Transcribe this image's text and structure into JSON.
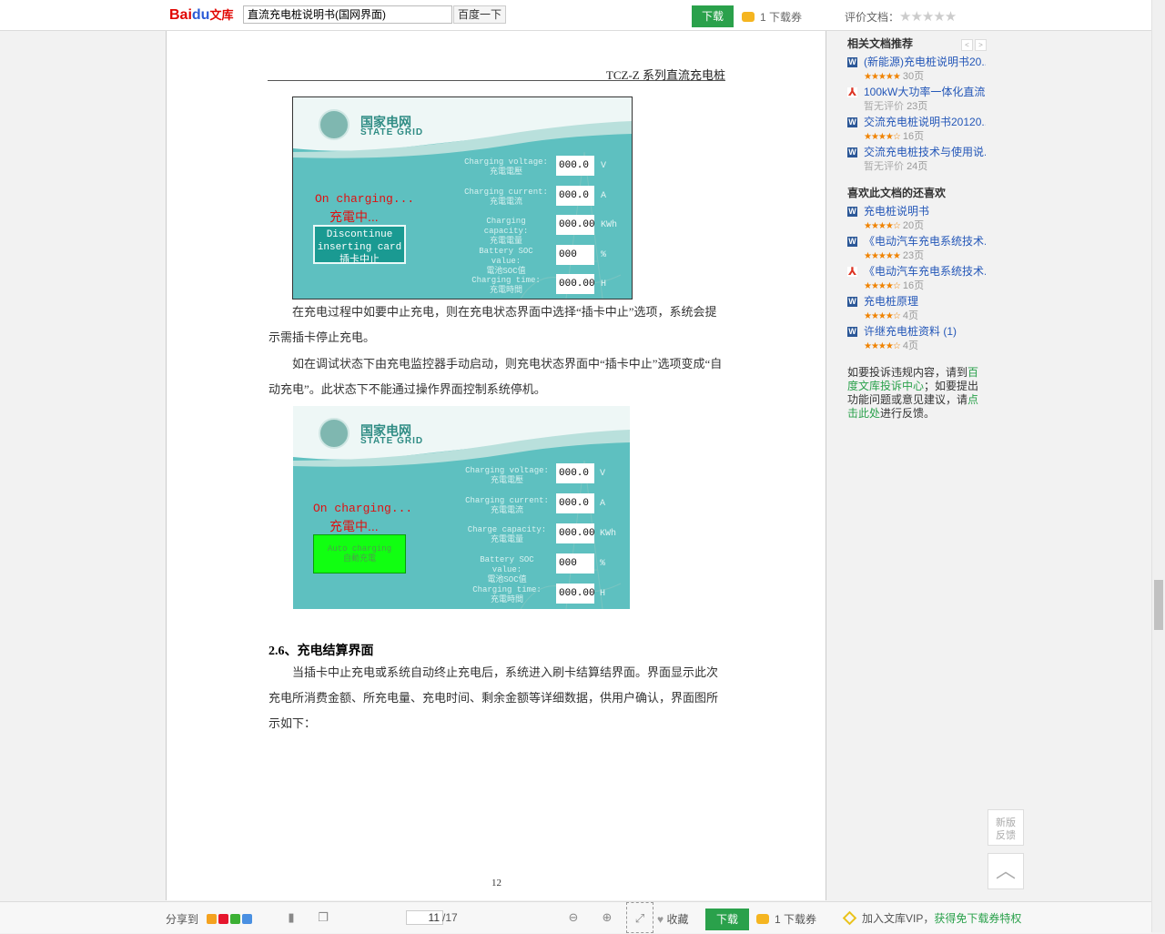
{
  "topbar": {
    "logo_bai": "Bai",
    "logo_du": "du",
    "logo_wk": "文库",
    "search_value": "直流充电桩说明书(国网界面)",
    "search_button": "百度一下",
    "download_label": "下载",
    "coupon_text": "1 下载券",
    "rate_label": "评价文档：",
    "rate_stars": "★★★★★"
  },
  "doc": {
    "header": "TCZ-Z 系列直流充电桩",
    "para1": "在充电过程中如要中止充电，则在充电状态界面中选择“插卡中止”选项，系统会提示需插卡停止充电。",
    "para2": "如在调试状态下由充电监控器手动启动，则充电状态界面中“插卡中止”选项变成“自动充电”。此状态下不能通过操作界面控制系统停机。",
    "section_num": "2.6、",
    "section_title": "充电结算界面",
    "para3": "当插卡中止充电或系统自动终止充电后，系统进入刷卡结算结界面。界面显示此次充电所消费金额、所充电量、充电时间、剩余金额等详细数据，供用户确认，界面图所示如下：",
    "page_number": "12"
  },
  "screen_common": {
    "brand_cn": "国家电网",
    "brand_en": "STATE GRID",
    "on_charging": "On charging...",
    "on_charging_cn": "充電中...",
    "fields": [
      {
        "en": "Charging  voltage:",
        "cn": "充電電壓",
        "value": "000.0",
        "unit": "V"
      },
      {
        "en": "Charging  current:",
        "cn": "充電電流",
        "value": "000.0",
        "unit": "A"
      },
      {
        "en": "Charging capacity:",
        "cn": "充電電量",
        "value": "000.00",
        "unit": "KWh"
      },
      {
        "en": "Battery SOC value:",
        "cn": "電池SOC值",
        "value": "000",
        "unit": "%"
      },
      {
        "en": "Charging    time:",
        "cn": "充電時間",
        "value": "000.00",
        "unit": "H"
      }
    ]
  },
  "screen1": {
    "button_line1": "Discontinue",
    "button_line2": "inserting card",
    "button_line3": "插卡中止"
  },
  "screen2": {
    "field3_en": "Charge  capacity:",
    "button_line1": "Auto  charging",
    "button_line2": "自動充電"
  },
  "sidebar": {
    "related_title": "相关文档推荐",
    "related": [
      {
        "type": "word",
        "title": "(新能源)充电桩说明书20...",
        "stars": "★★★★★",
        "rated": true,
        "pages": "30页"
      },
      {
        "type": "pdf",
        "title": "100kW大功率一体化直流...",
        "stars": "暂无评价",
        "rated": false,
        "pages": "23页"
      },
      {
        "type": "word",
        "title": "交流充电桩说明书20120...",
        "stars": "★★★★☆",
        "rated": true,
        "pages": "16页"
      },
      {
        "type": "word",
        "title": "交流充电桩技术与使用说...",
        "stars": "暂无评价",
        "rated": false,
        "pages": "24页"
      }
    ],
    "also_title": "喜欢此文档的还喜欢",
    "also": [
      {
        "type": "word",
        "title": "充电桩说明书",
        "stars": "★★★★☆",
        "pages": "20页"
      },
      {
        "type": "word",
        "title": "《电动汽车充电系统技术...",
        "stars": "★★★★★",
        "pages": "23页"
      },
      {
        "type": "pdf",
        "title": "《电动汽车充电系统技术...",
        "stars": "★★★★☆",
        "pages": "16页"
      },
      {
        "type": "word",
        "title": "充电桩原理",
        "stars": "★★★★☆",
        "pages": "4页"
      },
      {
        "type": "word",
        "title": "许继充电桩资料 (1)",
        "stars": "★★★★☆",
        "pages": "4页"
      }
    ],
    "report_pre": "如要投诉违规内容，请到",
    "report_link": "百度文库投诉中心",
    "report_mid": "；如要提出功能问题或意见建议，请",
    "report_link2": "点击此处",
    "report_post": "进行反馈。"
  },
  "float": {
    "feedback": "新版反馈"
  },
  "bottombar": {
    "share_label": "分享到",
    "current_page": "11",
    "total_pages": "/17",
    "favorite_label": "收藏",
    "download_label": "下载",
    "coupon_text": "1 下载券",
    "vip_text": "加入文库VIP，",
    "vip_link": "获得免下载券特权"
  }
}
